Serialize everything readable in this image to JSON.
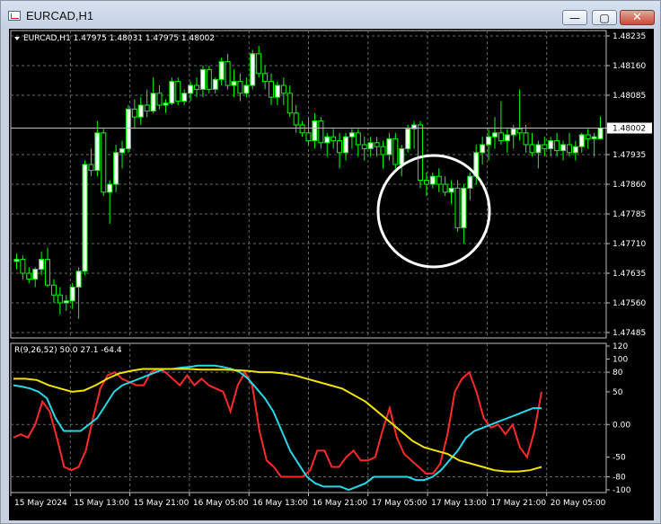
{
  "window": {
    "title": "EURCAD,H1",
    "buttons": {
      "minimize": "—",
      "maximize": "▢",
      "close": "✕"
    }
  },
  "chart_data": [
    {
      "type": "candlestick",
      "title": "EURCAD,H1  1.47975 1.48031 1.47975 1.48002",
      "current_price": "1.48002",
      "current_value": 1.48002,
      "y_ticks": [
        "1.48235",
        "1.48160",
        "1.48085",
        "1.48002",
        "1.47935",
        "1.47860",
        "1.47785",
        "1.47710",
        "1.47635",
        "1.47560",
        "1.47485"
      ],
      "ylim": [
        1.47485,
        1.48235
      ],
      "x_ticks": [
        "15 May 2024",
        "15 May 13:00",
        "15 May 21:00",
        "16 May 05:00",
        "16 May 13:00",
        "16 May 21:00",
        "17 May 05:00",
        "17 May 13:00",
        "17 May 21:00",
        "20 May 05:00"
      ],
      "bull_color": "#ffffff",
      "bear_color": "#000000",
      "wick_color": "#00ff00",
      "grid": true,
      "candles": [
        {
          "o": 1.47665,
          "h": 1.47685,
          "l": 1.47645,
          "c": 1.4767
        },
        {
          "o": 1.4767,
          "h": 1.4768,
          "l": 1.4762,
          "c": 1.47635
        },
        {
          "o": 1.47635,
          "h": 1.4765,
          "l": 1.4761,
          "c": 1.4762
        },
        {
          "o": 1.4762,
          "h": 1.4765,
          "l": 1.476,
          "c": 1.47645
        },
        {
          "o": 1.47645,
          "h": 1.4769,
          "l": 1.4763,
          "c": 1.4767
        },
        {
          "o": 1.4767,
          "h": 1.477,
          "l": 1.476,
          "c": 1.47605
        },
        {
          "o": 1.47605,
          "h": 1.4762,
          "l": 1.4756,
          "c": 1.4758
        },
        {
          "o": 1.4758,
          "h": 1.476,
          "l": 1.4753,
          "c": 1.4756
        },
        {
          "o": 1.4756,
          "h": 1.4758,
          "l": 1.4754,
          "c": 1.47565
        },
        {
          "o": 1.47565,
          "h": 1.4761,
          "l": 1.47545,
          "c": 1.476
        },
        {
          "o": 1.476,
          "h": 1.4765,
          "l": 1.4752,
          "c": 1.4764
        },
        {
          "o": 1.4764,
          "h": 1.4792,
          "l": 1.4763,
          "c": 1.4791
        },
        {
          "o": 1.4791,
          "h": 1.4795,
          "l": 1.4788,
          "c": 1.47895
        },
        {
          "o": 1.47895,
          "h": 1.4802,
          "l": 1.4788,
          "c": 1.4799
        },
        {
          "o": 1.4799,
          "h": 1.48,
          "l": 1.4783,
          "c": 1.4784
        },
        {
          "o": 1.4784,
          "h": 1.4787,
          "l": 1.4776,
          "c": 1.4786
        },
        {
          "o": 1.4786,
          "h": 1.4796,
          "l": 1.4784,
          "c": 1.4794
        },
        {
          "o": 1.4794,
          "h": 1.4797,
          "l": 1.479,
          "c": 1.4795
        },
        {
          "o": 1.4795,
          "h": 1.4806,
          "l": 1.4794,
          "c": 1.4805
        },
        {
          "o": 1.4805,
          "h": 1.48075,
          "l": 1.48,
          "c": 1.4803
        },
        {
          "o": 1.4803,
          "h": 1.4808,
          "l": 1.4801,
          "c": 1.4806
        },
        {
          "o": 1.4806,
          "h": 1.481,
          "l": 1.4803,
          "c": 1.48045
        },
        {
          "o": 1.48045,
          "h": 1.4813,
          "l": 1.4804,
          "c": 1.4809
        },
        {
          "o": 1.4809,
          "h": 1.4811,
          "l": 1.4805,
          "c": 1.4806
        },
        {
          "o": 1.4806,
          "h": 1.48075,
          "l": 1.4804,
          "c": 1.48065
        },
        {
          "o": 1.48065,
          "h": 1.4813,
          "l": 1.4806,
          "c": 1.4812
        },
        {
          "o": 1.4812,
          "h": 1.4813,
          "l": 1.4806,
          "c": 1.4807
        },
        {
          "o": 1.4807,
          "h": 1.481,
          "l": 1.4806,
          "c": 1.4809
        },
        {
          "o": 1.4809,
          "h": 1.4812,
          "l": 1.4807,
          "c": 1.4811
        },
        {
          "o": 1.4811,
          "h": 1.4813,
          "l": 1.4808,
          "c": 1.481
        },
        {
          "o": 1.481,
          "h": 1.4816,
          "l": 1.4808,
          "c": 1.4815
        },
        {
          "o": 1.4815,
          "h": 1.4816,
          "l": 1.4809,
          "c": 1.481
        },
        {
          "o": 1.481,
          "h": 1.4813,
          "l": 1.4809,
          "c": 1.48125
        },
        {
          "o": 1.48125,
          "h": 1.4818,
          "l": 1.4811,
          "c": 1.4817
        },
        {
          "o": 1.4817,
          "h": 1.4819,
          "l": 1.481,
          "c": 1.4811
        },
        {
          "o": 1.4811,
          "h": 1.4815,
          "l": 1.4808,
          "c": 1.4812
        },
        {
          "o": 1.4812,
          "h": 1.4814,
          "l": 1.4807,
          "c": 1.4809
        },
        {
          "o": 1.4809,
          "h": 1.4813,
          "l": 1.4808,
          "c": 1.4811
        },
        {
          "o": 1.4811,
          "h": 1.482,
          "l": 1.481,
          "c": 1.4819
        },
        {
          "o": 1.4819,
          "h": 1.4821,
          "l": 1.4813,
          "c": 1.4814
        },
        {
          "o": 1.4814,
          "h": 1.4816,
          "l": 1.481,
          "c": 1.4812
        },
        {
          "o": 1.4812,
          "h": 1.4814,
          "l": 1.4806,
          "c": 1.4808
        },
        {
          "o": 1.4808,
          "h": 1.4812,
          "l": 1.4806,
          "c": 1.4811
        },
        {
          "o": 1.4811,
          "h": 1.4813,
          "l": 1.4806,
          "c": 1.4809
        },
        {
          "o": 1.4809,
          "h": 1.4811,
          "l": 1.4803,
          "c": 1.4804
        },
        {
          "o": 1.4804,
          "h": 1.4806,
          "l": 1.4799,
          "c": 1.4801
        },
        {
          "o": 1.4801,
          "h": 1.4802,
          "l": 1.4798,
          "c": 1.4799
        },
        {
          "o": 1.4799,
          "h": 1.4803,
          "l": 1.4796,
          "c": 1.4797
        },
        {
          "o": 1.4797,
          "h": 1.4804,
          "l": 1.4795,
          "c": 1.4802
        },
        {
          "o": 1.4802,
          "h": 1.4803,
          "l": 1.4795,
          "c": 1.47965
        },
        {
          "o": 1.47965,
          "h": 1.4799,
          "l": 1.4793,
          "c": 1.4798
        },
        {
          "o": 1.4798,
          "h": 1.48,
          "l": 1.4795,
          "c": 1.4797
        },
        {
          "o": 1.4797,
          "h": 1.4799,
          "l": 1.479,
          "c": 1.4794
        },
        {
          "o": 1.4794,
          "h": 1.4799,
          "l": 1.4792,
          "c": 1.4798
        },
        {
          "o": 1.4798,
          "h": 1.48,
          "l": 1.4795,
          "c": 1.4799
        },
        {
          "o": 1.4799,
          "h": 1.48,
          "l": 1.4793,
          "c": 1.4796
        },
        {
          "o": 1.4796,
          "h": 1.4798,
          "l": 1.4792,
          "c": 1.4795
        },
        {
          "o": 1.4795,
          "h": 1.4798,
          "l": 1.4793,
          "c": 1.47965
        },
        {
          "o": 1.47965,
          "h": 1.4798,
          "l": 1.4793,
          "c": 1.47955
        },
        {
          "o": 1.47955,
          "h": 1.4797,
          "l": 1.479,
          "c": 1.47935
        },
        {
          "o": 1.47935,
          "h": 1.4799,
          "l": 1.4792,
          "c": 1.47975
        },
        {
          "o": 1.47975,
          "h": 1.4799,
          "l": 1.479,
          "c": 1.4791
        },
        {
          "o": 1.4791,
          "h": 1.4796,
          "l": 1.4788,
          "c": 1.4795
        },
        {
          "o": 1.4795,
          "h": 1.4801,
          "l": 1.4794,
          "c": 1.48
        },
        {
          "o": 1.48,
          "h": 1.4802,
          "l": 1.4795,
          "c": 1.4801
        },
        {
          "o": 1.4801,
          "h": 1.4802,
          "l": 1.4785,
          "c": 1.4787
        },
        {
          "o": 1.4787,
          "h": 1.4789,
          "l": 1.4783,
          "c": 1.4786
        },
        {
          "o": 1.4786,
          "h": 1.4789,
          "l": 1.4785,
          "c": 1.4788
        },
        {
          "o": 1.4788,
          "h": 1.479,
          "l": 1.4784,
          "c": 1.4786
        },
        {
          "o": 1.4786,
          "h": 1.4788,
          "l": 1.4783,
          "c": 1.4784
        },
        {
          "o": 1.4784,
          "h": 1.4787,
          "l": 1.4781,
          "c": 1.4785
        },
        {
          "o": 1.4785,
          "h": 1.4787,
          "l": 1.4774,
          "c": 1.4775
        },
        {
          "o": 1.4775,
          "h": 1.4786,
          "l": 1.4771,
          "c": 1.4785
        },
        {
          "o": 1.4785,
          "h": 1.4789,
          "l": 1.4782,
          "c": 1.4788
        },
        {
          "o": 1.4788,
          "h": 1.4796,
          "l": 1.4786,
          "c": 1.4794
        },
        {
          "o": 1.4794,
          "h": 1.4798,
          "l": 1.4791,
          "c": 1.4796
        },
        {
          "o": 1.4796,
          "h": 1.48,
          "l": 1.4792,
          "c": 1.4798
        },
        {
          "o": 1.4798,
          "h": 1.4803,
          "l": 1.4795,
          "c": 1.4799
        },
        {
          "o": 1.4799,
          "h": 1.4807,
          "l": 1.4796,
          "c": 1.4797
        },
        {
          "o": 1.4797,
          "h": 1.48,
          "l": 1.4794,
          "c": 1.47985
        },
        {
          "o": 1.47985,
          "h": 1.4801,
          "l": 1.4795,
          "c": 1.48
        },
        {
          "o": 1.48,
          "h": 1.481,
          "l": 1.4797,
          "c": 1.4799
        },
        {
          "o": 1.4799,
          "h": 1.4801,
          "l": 1.4794,
          "c": 1.4796
        },
        {
          "o": 1.4796,
          "h": 1.4799,
          "l": 1.4793,
          "c": 1.4794
        },
        {
          "o": 1.4794,
          "h": 1.4797,
          "l": 1.479,
          "c": 1.4796
        },
        {
          "o": 1.4796,
          "h": 1.4798,
          "l": 1.4793,
          "c": 1.4795
        },
        {
          "o": 1.4795,
          "h": 1.4798,
          "l": 1.4793,
          "c": 1.4797
        },
        {
          "o": 1.4797,
          "h": 1.4799,
          "l": 1.4793,
          "c": 1.47945
        },
        {
          "o": 1.47945,
          "h": 1.4797,
          "l": 1.4792,
          "c": 1.4796
        },
        {
          "o": 1.4796,
          "h": 1.4799,
          "l": 1.4793,
          "c": 1.4794
        },
        {
          "o": 1.4794,
          "h": 1.4797,
          "l": 1.4792,
          "c": 1.47955
        },
        {
          "o": 1.47955,
          "h": 1.4799,
          "l": 1.4794,
          "c": 1.47985
        },
        {
          "o": 1.47985,
          "h": 1.48,
          "l": 1.4795,
          "c": 1.47975
        },
        {
          "o": 1.47975,
          "h": 1.4799,
          "l": 1.4793,
          "c": 1.4798
        },
        {
          "o": 1.47975,
          "h": 1.48031,
          "l": 1.47975,
          "c": 1.48002
        }
      ]
    },
    {
      "type": "line",
      "title": "R(9,26,52) 50.0 27.1 -64.4",
      "y_ticks": [
        "120",
        "100",
        "80",
        "50",
        "0.00",
        "-50",
        "-80",
        "-100"
      ],
      "ylim": [
        -100,
        120
      ],
      "series": [
        {
          "color": "#ff2a2a",
          "values": [
            -20,
            -15,
            -20,
            0,
            35,
            20,
            -20,
            -65,
            -70,
            -65,
            -40,
            10,
            55,
            75,
            80,
            70,
            65,
            60,
            60,
            80,
            85,
            80,
            70,
            60,
            75,
            60,
            70,
            60,
            55,
            50,
            20,
            60,
            80,
            60,
            -10,
            -55,
            -65,
            -80,
            -80,
            -80,
            -80,
            -70,
            -40,
            -40,
            -65,
            -65,
            -50,
            -40,
            -55,
            -55,
            -50,
            -10,
            25,
            -20,
            -45,
            -55,
            -65,
            -75,
            -75,
            -60,
            -15,
            50,
            70,
            80,
            50,
            10,
            -5,
            0,
            -15,
            0,
            -35,
            -50,
            -10,
            50
          ]
        },
        {
          "color": "#29d8e8",
          "values": [
            60,
            58,
            55,
            50,
            40,
            10,
            -10,
            -10,
            -10,
            0,
            10,
            30,
            50,
            60,
            65,
            70,
            75,
            80,
            85,
            85,
            87,
            88,
            90,
            90,
            90,
            88,
            85,
            80,
            70,
            55,
            40,
            20,
            -10,
            -40,
            -60,
            -80,
            -90,
            -95,
            -95,
            -95,
            -100,
            -95,
            -90,
            -80,
            -80,
            -80,
            -80,
            -80,
            -85,
            -85,
            -80,
            -70,
            -55,
            -40,
            -20,
            -10,
            -5,
            0,
            5,
            10,
            15,
            20,
            25,
            25
          ]
        },
        {
          "color": "#f2e300",
          "values": [
            70,
            70,
            68,
            60,
            55,
            50,
            52,
            60,
            70,
            78,
            82,
            85,
            85,
            85,
            85,
            85,
            84,
            84,
            84,
            83,
            82,
            80,
            80,
            78,
            75,
            70,
            65,
            60,
            55,
            45,
            35,
            20,
            5,
            -10,
            -25,
            -35,
            -40,
            -45,
            -55,
            -60,
            -65,
            -70,
            -72,
            -72,
            -70,
            -65
          ]
        }
      ]
    }
  ]
}
